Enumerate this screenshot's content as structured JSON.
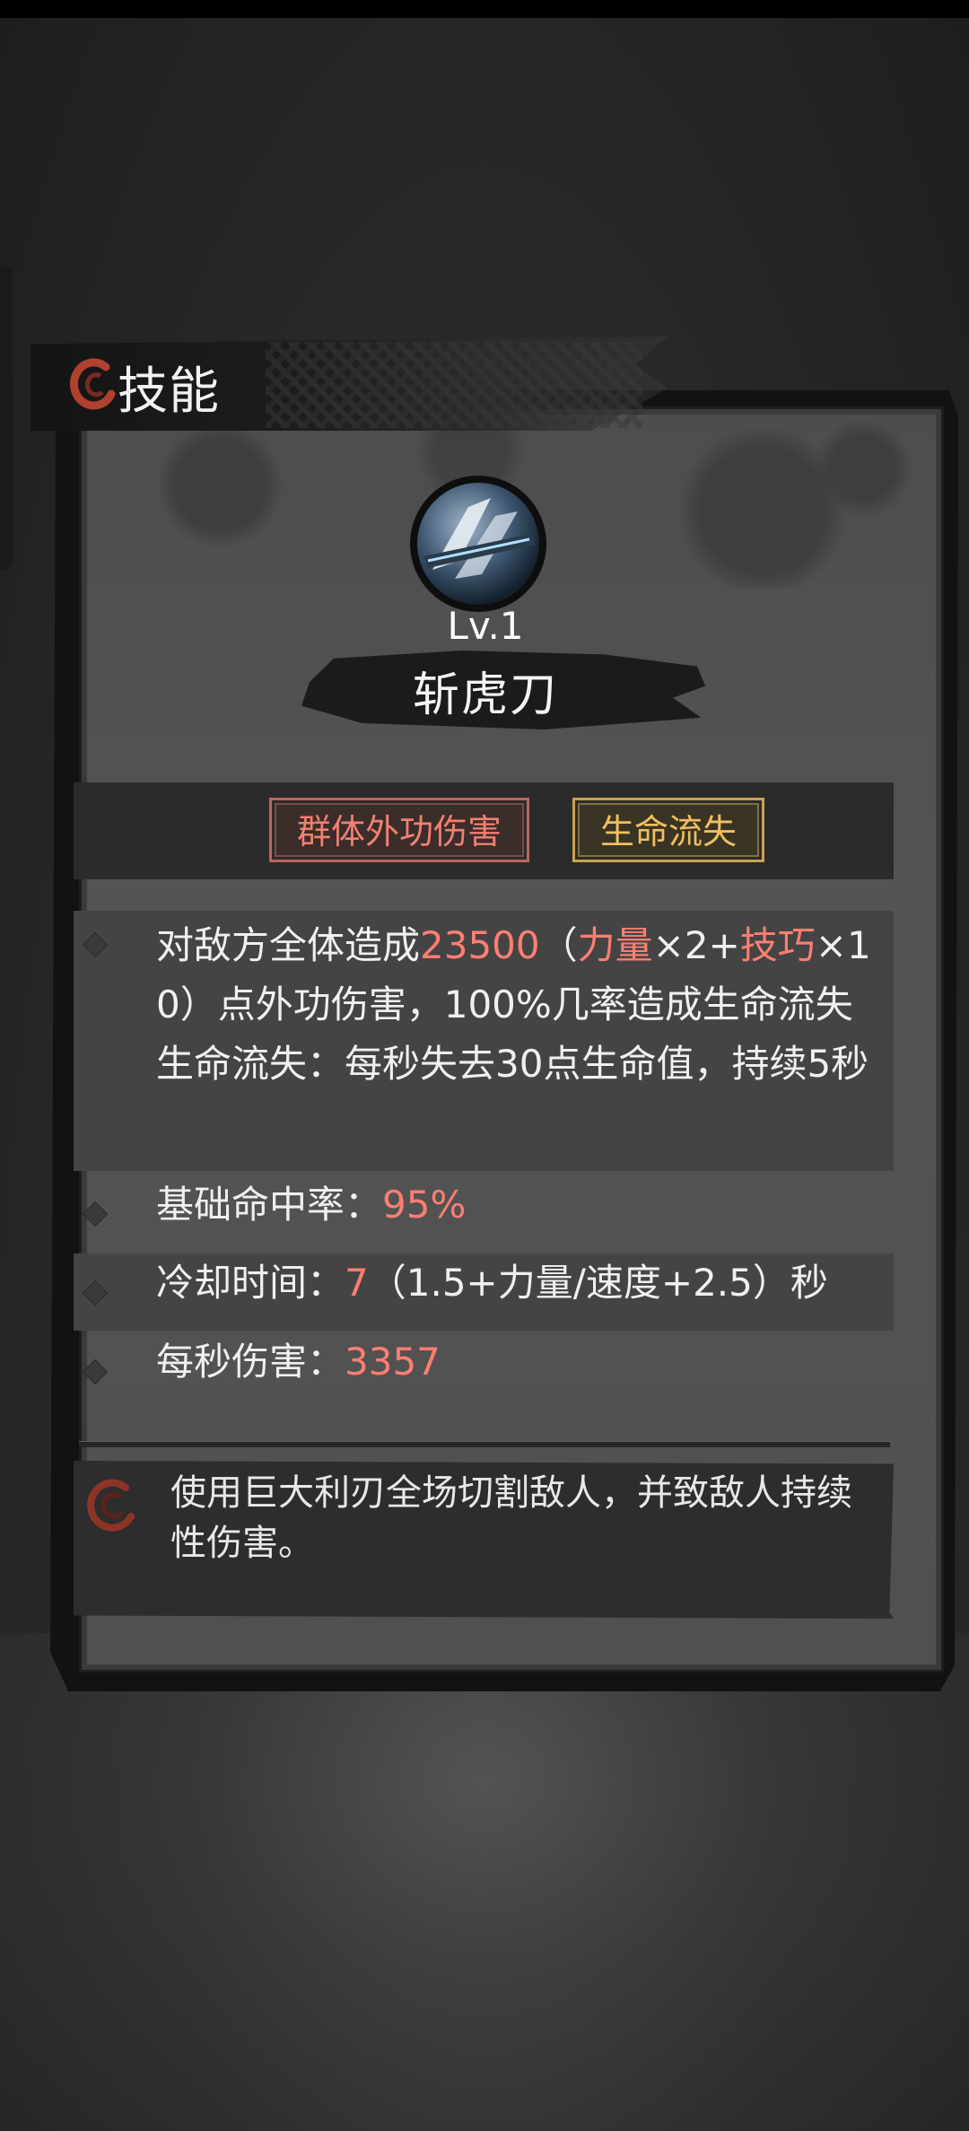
{
  "panel": {
    "title": "技能"
  },
  "skill": {
    "level": "Lv.1",
    "name": "斩虎刀",
    "tags": {
      "primary": "群体外功伤害",
      "secondary": "生命流失"
    }
  },
  "stats": {
    "effect": {
      "t1": "对敌方全体造成",
      "damage_value": "23500",
      "t2": "（",
      "attr1": "力量",
      "t3": "×2+",
      "attr2": "技巧",
      "t4": "×10）点外功伤害，100%几率造成生命流失",
      "t5": "生命流失：每秒失去30点生命值，持续5秒"
    },
    "hit_rate": {
      "label": "基础命中率：",
      "value": "95%"
    },
    "cooldown": {
      "label": "冷却时间：",
      "value": "7",
      "formula": "（1.5+力量/速度+2.5）秒"
    },
    "dps": {
      "label": "每秒伤害：",
      "value": "3357"
    }
  },
  "description": "使用巨大利刃全场切割敌人，并致敌人持续性伤害。",
  "colors": {
    "highlight_red": "#ff7e72",
    "tag_gold": "#f0c060",
    "panel_gray": "#505050"
  },
  "icons": {
    "title": "red-swirl-icon",
    "skill": "blade-slash-icon",
    "description": "red-swirl-icon"
  }
}
